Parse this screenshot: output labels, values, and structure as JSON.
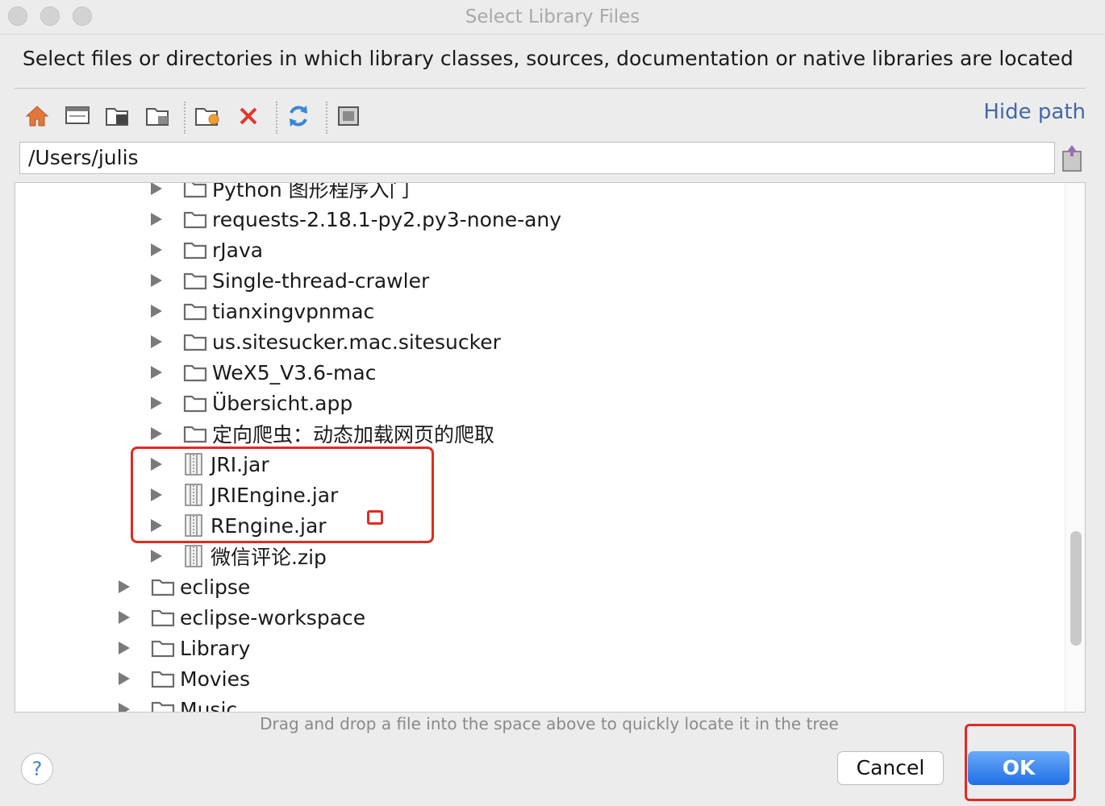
{
  "window": {
    "title": "Select Library Files"
  },
  "instruction": "Select files or directories in which library classes, sources, documentation or native libraries are located",
  "toolbar": {
    "icons": [
      "home-icon",
      "desktop-icon",
      "project-folder-icon",
      "module-folder-icon",
      "new-folder-icon",
      "delete-icon",
      "refresh-icon",
      "show-hidden-icon"
    ],
    "hide_path": "Hide path"
  },
  "path": {
    "value": "/Users/julis"
  },
  "tree": {
    "items": [
      {
        "label": "Python 图形程序入门",
        "type": "folder"
      },
      {
        "label": "requests-2.18.1-py2.py3-none-any",
        "type": "folder"
      },
      {
        "label": "rJava",
        "type": "folder"
      },
      {
        "label": "Single-thread-crawler",
        "type": "folder"
      },
      {
        "label": "tianxingvpnmac",
        "type": "folder"
      },
      {
        "label": "us.sitesucker.mac.sitesucker",
        "type": "folder"
      },
      {
        "label": "WeX5_V3.6-mac",
        "type": "folder"
      },
      {
        "label": "Übersicht.app",
        "type": "folder"
      },
      {
        "label": "定向爬虫：动态加载网页的爬取",
        "type": "folder"
      },
      {
        "label": "JRI.jar",
        "type": "jar"
      },
      {
        "label": "JRIEngine.jar",
        "type": "jar"
      },
      {
        "label": "REngine.jar",
        "type": "jar"
      },
      {
        "label": "微信评论.zip",
        "type": "zip"
      },
      {
        "label": "eclipse",
        "type": "folder"
      },
      {
        "label": "eclipse-workspace",
        "type": "folder"
      },
      {
        "label": "Library",
        "type": "folder"
      },
      {
        "label": "Movies",
        "type": "folder"
      },
      {
        "label": "Music",
        "type": "folder"
      }
    ]
  },
  "hint": "Drag and drop a file into the space above to quickly locate it in the tree",
  "buttons": {
    "help": "?",
    "cancel": "Cancel",
    "ok": "OK"
  },
  "colors": {
    "accent": "#1f6fe6",
    "highlight": "#e02b20",
    "link": "#4468a8",
    "folder_icon": "#6b6b6b"
  }
}
